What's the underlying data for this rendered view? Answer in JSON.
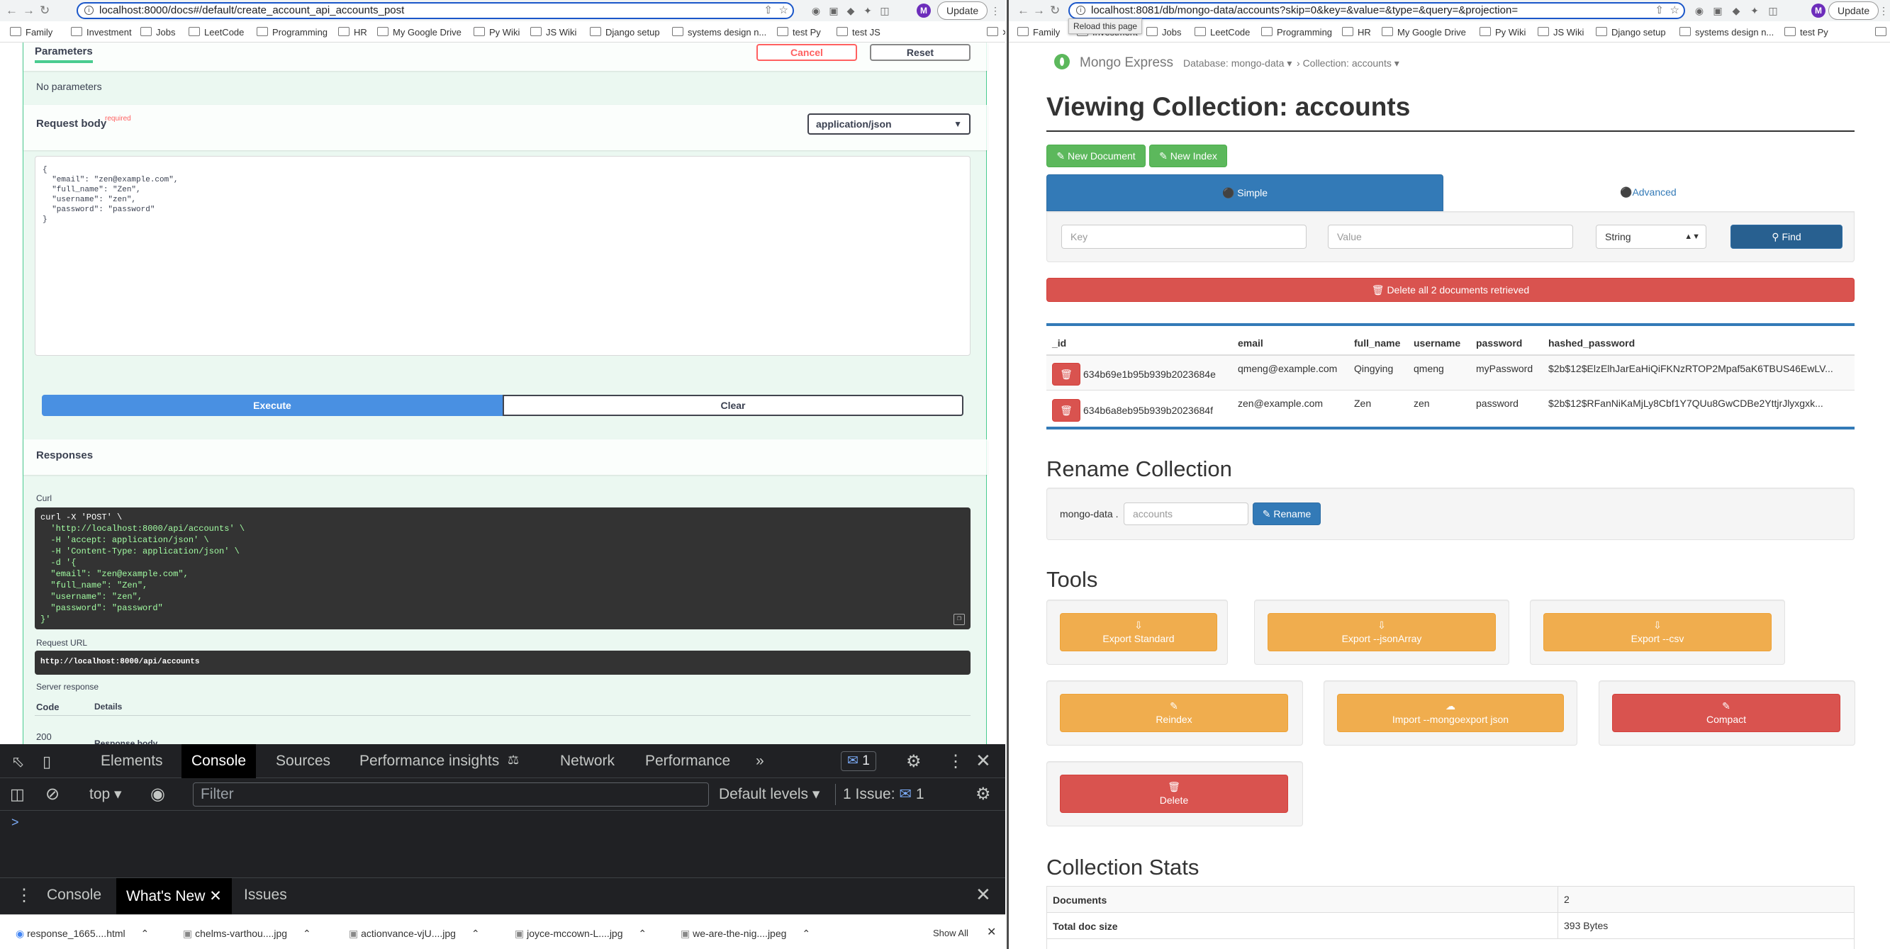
{
  "left_browser": {
    "url": "localhost:8000/docs#/default/create_account_api_accounts_post",
    "update_label": "Update",
    "avatar": "M",
    "bookmarks": [
      "Family",
      "Investment",
      "Jobs",
      "LeetCode",
      "Programming",
      "HR",
      "My Google Drive",
      "Py Wiki",
      "JS Wiki",
      "Django setup",
      "systems design n...",
      "test Py",
      "test JS"
    ]
  },
  "swagger": {
    "parameters_label": "Parameters",
    "cancel_label": "Cancel",
    "reset_label": "Reset",
    "no_parameters": "No parameters",
    "request_body_label": "Request body",
    "required_label": "required",
    "content_type": "application/json",
    "body_lines": [
      "{",
      "  \"email\": \"zen@example.com\",",
      "  \"full_name\": \"Zen\",",
      "  \"username\": \"zen\",",
      "  \"password\": \"password\"",
      "}"
    ],
    "execute_label": "Execute",
    "clear_label": "Clear",
    "responses_label": "Responses",
    "curl_label": "Curl",
    "curl_lines": [
      "curl -X 'POST' \\",
      "  'http://localhost:8000/api/accounts' \\",
      "  -H 'accept: application/json' \\",
      "  -H 'Content-Type: application/json' \\",
      "  -d '{",
      "  \"email\": \"zen@example.com\",",
      "  \"full_name\": \"Zen\",",
      "  \"username\": \"zen\",",
      "  \"password\": \"password\"",
      "}'"
    ],
    "request_url_label": "Request URL",
    "request_url": "http://localhost:8000/api/accounts",
    "server_response_label": "Server response",
    "code_header": "Code",
    "details_header": "Details",
    "code_value": "200",
    "response_body_label": "Response body"
  },
  "devtools": {
    "tabs": [
      "Elements",
      "Console",
      "Sources",
      "Performance insights",
      "Network",
      "Performance"
    ],
    "active_tab": "Console",
    "issues_count": "1",
    "context": "top",
    "filter_placeholder": "Filter",
    "levels": "Default levels",
    "issue_label": "1 Issue:",
    "issue_count2": "1",
    "prompt": ">",
    "drawer_tabs": [
      "Console",
      "What's New",
      "Issues"
    ]
  },
  "downloads": {
    "items": [
      "response_1665....html",
      "chelms-varthou....jpg",
      "actionvance-vjU....jpg",
      "joyce-mccown-L....jpg",
      "we-are-the-nig....jpeg"
    ],
    "show_all": "Show All"
  },
  "right_browser": {
    "url": "localhost:8081/db/mongo-data/accounts?skip=0&key=&value=&type=&query=&projection=",
    "tooltip": "Reload this page",
    "update_label": "Update",
    "avatar": "M",
    "bookmarks": [
      "Family",
      "Investment",
      "Jobs",
      "LeetCode",
      "Programming",
      "HR",
      "My Google Drive",
      "Py Wiki",
      "JS Wiki",
      "Django setup",
      "systems design n...",
      "test Py"
    ]
  },
  "mongo": {
    "brand": "Mongo Express",
    "database_crumb": "Database: mongo-data",
    "collection_crumb": "Collection: accounts",
    "title": "Viewing Collection: accounts",
    "new_document": "New Document",
    "new_index": "New Index",
    "simple_tab": "Simple",
    "advanced_tab": "Advanced",
    "key_placeholder": "Key",
    "value_placeholder": "Value",
    "type_value": "String",
    "find_label": "Find",
    "delete_all_label": "Delete all 2 documents retrieved",
    "columns": [
      "_id",
      "email",
      "full_name",
      "username",
      "password",
      "hashed_password"
    ],
    "rows": [
      {
        "id": "634b69e1b95b939b2023684e",
        "email": "qmeng@example.com",
        "full_name": "Qingying",
        "username": "qmeng",
        "password": "myPassword",
        "hashed_password": "$2b$12$ElzElhJarEaHiQiFKNzRTOP2Mpaf5aK6TBUS46EwLV..."
      },
      {
        "id": "634b6a8eb95b939b2023684f",
        "email": "zen@example.com",
        "full_name": "Zen",
        "username": "zen",
        "password": "password",
        "hashed_password": "$2b$12$RFanNiKaMjLy8Cbf1Y7QUu8GwCDBe2YttjrJlyxgxk..."
      }
    ],
    "rename_title": "Rename Collection",
    "rename_prefix": "mongo-data .",
    "rename_placeholder": "accounts",
    "rename_button": "Rename",
    "tools_title": "Tools",
    "export_standard": "Export Standard",
    "export_json_array": "Export --jsonArray",
    "export_csv": "Export --csv",
    "reindex": "Reindex",
    "import_label": "Import --mongoexport json",
    "compact": "Compact",
    "delete": "Delete",
    "stats_title": "Collection Stats",
    "stats": [
      {
        "label": "Documents",
        "value": "2"
      },
      {
        "label": "Total doc size",
        "value": "393 Bytes"
      }
    ]
  },
  "colors": {
    "swagger_green": "#49cc90",
    "execute_blue": "#4990e2",
    "mongo_green": "#5cb85c",
    "mongo_blue": "#337ab7",
    "mongo_red": "#d9534f",
    "mongo_orange": "#f0ad4e"
  }
}
